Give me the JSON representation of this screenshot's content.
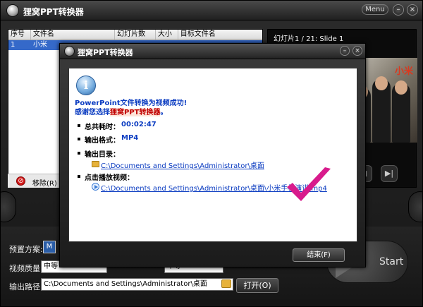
{
  "app": {
    "title": "狸窝PPT转换器",
    "menu_label": "Menu",
    "minimize_glyph": "–",
    "close_glyph": "×"
  },
  "file_list": {
    "columns": [
      "序号",
      "文件名",
      "幻灯片数",
      "大小",
      "目标文件名"
    ],
    "rows": [
      {
        "index": "1",
        "name": "小米"
      }
    ],
    "remove_label": "移除(R)"
  },
  "preview": {
    "slide_label": "幻灯片1 / 21: Slide 1",
    "photo_text": "小米"
  },
  "settings": {
    "preset_label": "预置方案:",
    "preset_icon_text": "M",
    "quality_label": "视频质量:",
    "quality_value": "中等",
    "quality2_value": "中等",
    "output_label": "输出路径:",
    "output_path": "C:\\Documents and Settings\\Administrator\\桌面",
    "open_button": "打开(O)",
    "start_button": "Start"
  },
  "dialog": {
    "title": "狸窝PPT转换器",
    "success_line": "PowerPoint文件转换为视频成功!",
    "thanks_prefix": "感谢您选择",
    "thanks_brand": "狸窝PPT转换器",
    "thanks_suffix": "。",
    "total_time_label": "总共耗时：",
    "total_time_value": "00:02:47",
    "format_label": "输出格式：",
    "format_value": "MP4",
    "output_dir_label": "输出目录：",
    "output_dir_link": "C:\\Documents and Settings\\Administrator\\桌面",
    "play_label": "点击播放视频：",
    "video_link": "C:\\Documents and Settings\\Administrator\\桌面\\小米手机演讲.mp4",
    "finish_button": "结束(F)",
    "info_glyph": "i",
    "checkmark_color": "#d81b8c"
  },
  "icons": {
    "remove": "remove-icon",
    "folder": "folder-icon",
    "play": "play-icon",
    "info": "info-icon",
    "check": "checkmark-icon"
  }
}
